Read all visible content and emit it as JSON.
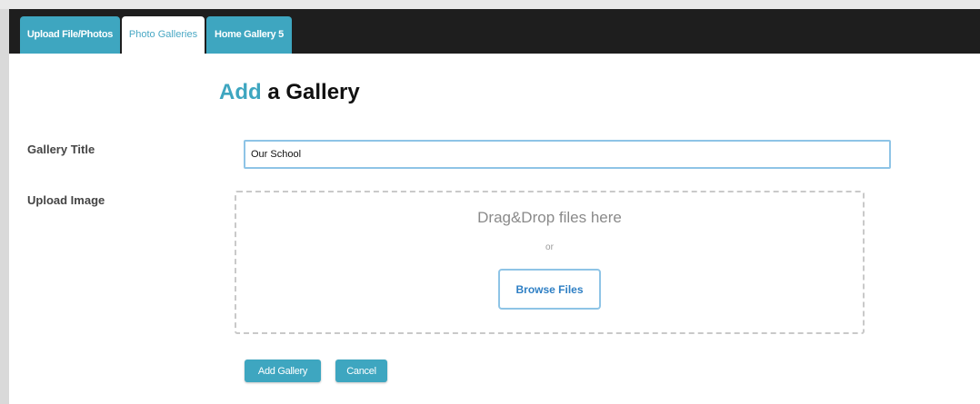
{
  "tabs": [
    {
      "label": "Upload File/Photos",
      "active": false
    },
    {
      "label": "Photo Galleries",
      "active": true
    },
    {
      "label": "Home Gallery 5",
      "active": false
    }
  ],
  "heading": {
    "accent": "Add",
    "rest": " a Gallery"
  },
  "form": {
    "gallery_title_label": "Gallery Title",
    "gallery_title_value": "Our School",
    "upload_image_label": "Upload Image"
  },
  "dropzone": {
    "drop_text": "Drag&Drop files here",
    "or_text": "or",
    "browse_label": "Browse Files"
  },
  "actions": {
    "add_label": "Add Gallery",
    "cancel_label": "Cancel"
  },
  "colors": {
    "accent": "#3ea6c0",
    "tabbar": "#1e1e1e",
    "input_border": "#8ec4e6",
    "link_blue": "#2e7fc4"
  }
}
